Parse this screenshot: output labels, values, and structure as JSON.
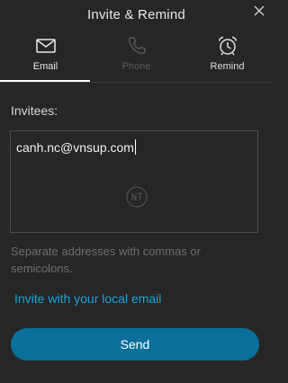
{
  "window": {
    "title": "Invite & Remind",
    "close_icon": "close-icon"
  },
  "tabs": [
    {
      "label": "Email",
      "icon": "envelope-icon",
      "active": true
    },
    {
      "label": "Phone",
      "icon": "phone-icon",
      "active": false,
      "disabled": true
    },
    {
      "label": "Remind",
      "icon": "alarm-clock-icon",
      "active": false
    }
  ],
  "form": {
    "invitees_label": "Invitees:",
    "invitees_value": "canh.nc@vnsup.com",
    "hint": "Separate addresses with commas or semicolons.",
    "local_email_link": "Invite with your local email",
    "send_label": "Send"
  },
  "colors": {
    "background": "#262626",
    "accent_link": "#1aa3d6",
    "send_button": "#0a6f9a",
    "hint_text": "#6e6e6e",
    "disabled_tab": "#5a5a5a"
  }
}
